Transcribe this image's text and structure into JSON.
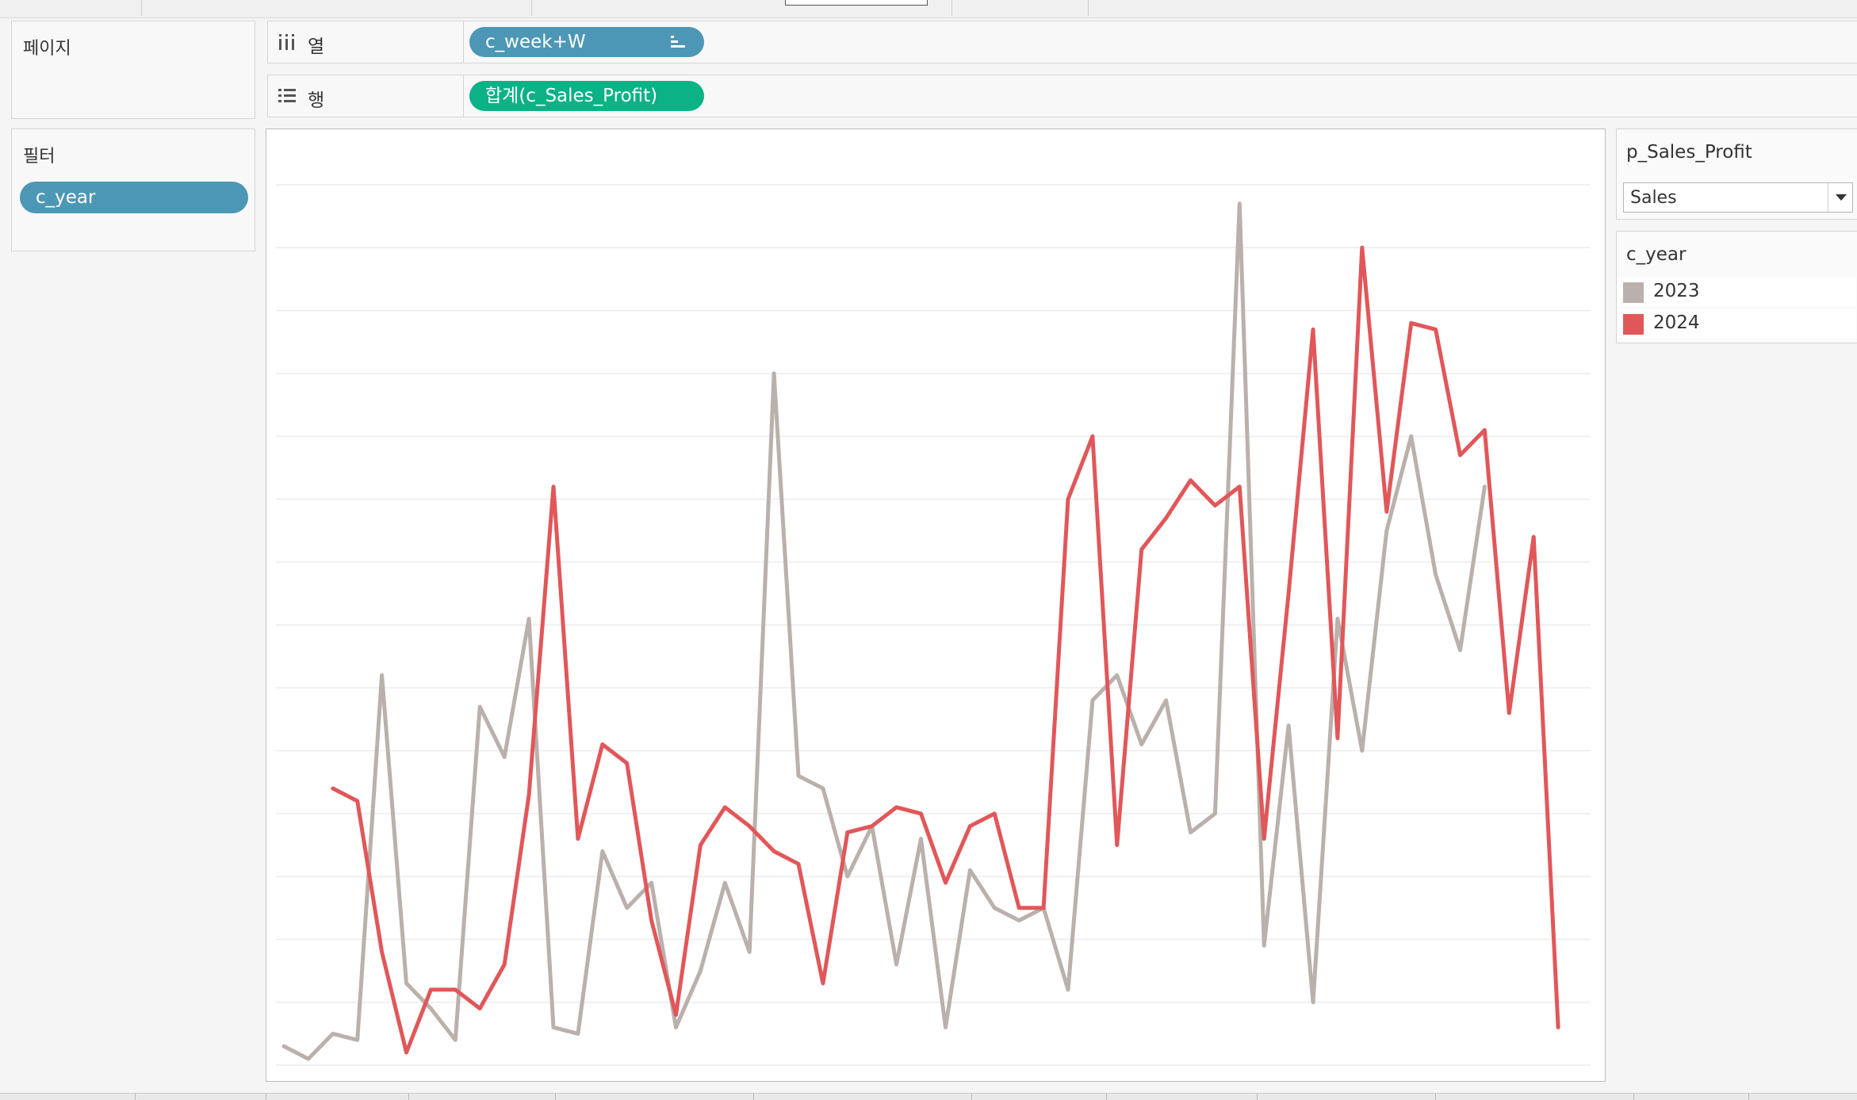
{
  "shelves": {
    "pages": {
      "title": "페이지"
    },
    "columns": {
      "label": "열",
      "pill": "c_week+W",
      "icon": "columns-icon"
    },
    "rows": {
      "label": "행",
      "pill": "합계(c_Sales_Profit)",
      "icon": "rows-icon"
    },
    "filters": {
      "title": "필터",
      "pill": "c_year"
    }
  },
  "parameter": {
    "title": "p_Sales_Profit",
    "value": "Sales"
  },
  "legend": {
    "title": "c_year",
    "items": [
      {
        "label": "2023",
        "color": "#bab0ac"
      },
      {
        "label": "2024",
        "color": "#e15759"
      }
    ]
  },
  "chart_data": {
    "type": "line",
    "xlabel": "",
    "ylabel": "",
    "grid": true,
    "legend_position": "right",
    "x": [
      1,
      2,
      3,
      4,
      5,
      6,
      7,
      8,
      9,
      10,
      11,
      12,
      13,
      14,
      15,
      16,
      17,
      18,
      19,
      20,
      21,
      22,
      23,
      24,
      25,
      26,
      27,
      28,
      29,
      30,
      31,
      32,
      33,
      34,
      35,
      36,
      37,
      38,
      39,
      40,
      41,
      42,
      43,
      44,
      45,
      46,
      47,
      48,
      49,
      50,
      51,
      52,
      53,
      54
    ],
    "ylim": [
      0,
      14
    ],
    "series": [
      {
        "name": "2023",
        "color": "#bab0ac",
        "values": [
          0.3,
          0.1,
          0.5,
          0.4,
          6.2,
          1.3,
          0.9,
          0.4,
          5.7,
          4.9,
          7.1,
          0.6,
          0.5,
          3.4,
          2.5,
          2.9,
          0.6,
          1.5,
          2.9,
          1.8,
          11.0,
          4.6,
          4.4,
          3.0,
          3.8,
          1.6,
          3.6,
          0.6,
          3.1,
          2.5,
          2.3,
          2.5,
          1.2,
          5.8,
          6.2,
          5.1,
          5.8,
          3.7,
          4.0,
          13.7,
          1.9,
          5.4,
          1.0,
          7.1,
          5.0,
          8.5,
          10.0,
          7.8,
          6.6,
          9.2,
          null,
          null,
          null,
          null
        ]
      },
      {
        "name": "2024",
        "color": "#e15759",
        "values": [
          null,
          null,
          4.4,
          4.2,
          1.8,
          0.2,
          1.2,
          1.2,
          0.9,
          1.6,
          4.3,
          9.2,
          3.6,
          5.1,
          4.8,
          2.3,
          0.8,
          3.5,
          4.1,
          3.8,
          3.4,
          3.2,
          1.3,
          3.7,
          3.8,
          4.1,
          4.0,
          2.9,
          3.8,
          4.0,
          2.5,
          2.5,
          9.0,
          10.0,
          3.5,
          8.2,
          8.7,
          9.3,
          8.9,
          9.2,
          3.6,
          7.5,
          11.7,
          5.2,
          13.0,
          8.8,
          11.8,
          11.7,
          9.7,
          10.1,
          5.6,
          8.4,
          0.6,
          null
        ]
      }
    ]
  }
}
